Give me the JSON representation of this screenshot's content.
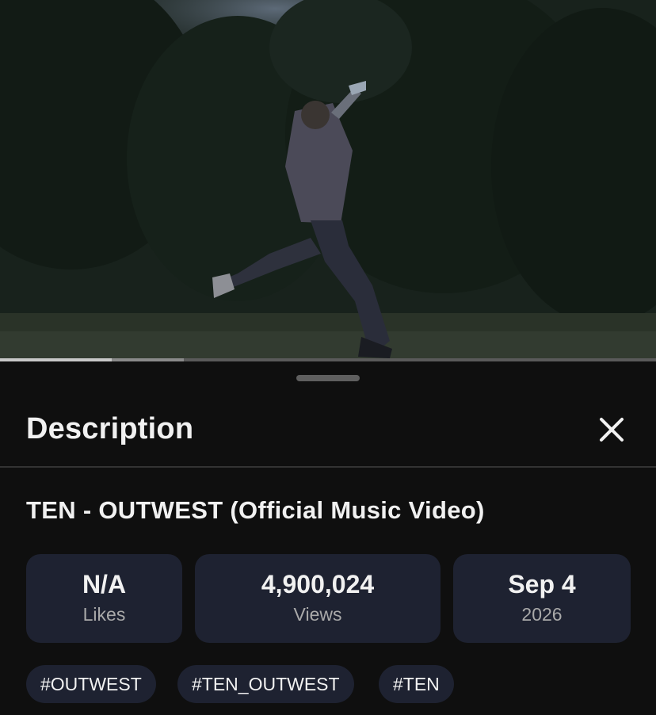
{
  "video": {
    "progress_played_fraction": 0.17,
    "progress_buffered_fraction": 0.28
  },
  "sheet": {
    "title": "Description",
    "close_icon": "close-icon"
  },
  "video_title": "TEN - OUTWEST (Official Music Video)",
  "stats": {
    "likes_value": "N/A",
    "likes_label": "Likes",
    "views_value": "4,900,024",
    "views_label": "Views",
    "date_value": "Sep 4",
    "date_label": "2026"
  },
  "hashtags": [
    "#OUTWEST",
    "#TEN_OUTWEST",
    "#TEN"
  ],
  "colors": {
    "background": "#0f0f0f",
    "chip": "#1e2231",
    "text": "#f1f1f1",
    "muted": "#a9a9a9"
  }
}
